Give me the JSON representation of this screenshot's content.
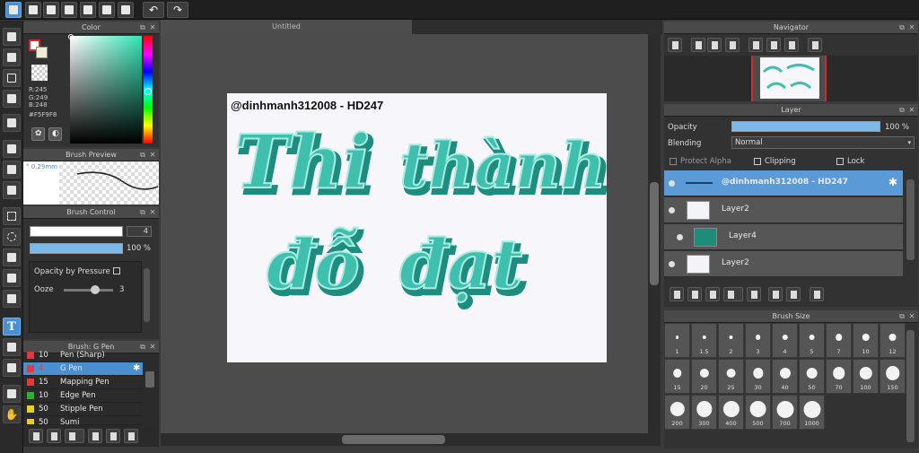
{
  "document_tab": "Untitled",
  "panels": {
    "color": {
      "title": "Color",
      "r": "R:245",
      "g": "G:249",
      "b": "B:248",
      "hex": "#F5F9F8"
    },
    "brush_preview": {
      "title": "Brush Preview",
      "size": "0.29mm"
    },
    "brush_control": {
      "title": "Brush Control",
      "size_value": "4",
      "opacity_value": "100 %",
      "opacity_by_pressure": "Opacity by Pressure",
      "ooze_label": "Ooze",
      "ooze_value": "3"
    },
    "brush_list": {
      "title": "Brush: G Pen",
      "items": [
        {
          "n": "10",
          "name": "Pen (Sharp)",
          "color": "#e03a3a"
        },
        {
          "n": "4",
          "name": "G Pen",
          "color": "#e03a3a",
          "selected": true
        },
        {
          "n": "15",
          "name": "Mapping Pen",
          "color": "#e03a3a"
        },
        {
          "n": "10",
          "name": "Edge Pen",
          "color": "#2db02d"
        },
        {
          "n": "50",
          "name": "Stipple Pen",
          "color": "#e8d020"
        },
        {
          "n": "50",
          "name": "Sumi",
          "color": "#e8d020"
        }
      ]
    },
    "navigator": {
      "title": "Navigator"
    },
    "layer": {
      "title": "Layer",
      "opacity_label": "Opacity",
      "opacity_value": "100 %",
      "blending_label": "Blending",
      "blending_value": "Normal",
      "protect_alpha": "Protect Alpha",
      "clipping": "Clipping",
      "lock": "Lock",
      "layers": [
        {
          "name": "@dinhmanh312008 - HD247",
          "kind": "text",
          "selected": true
        },
        {
          "name": "Layer2",
          "kind": "image"
        },
        {
          "name": "Layer4",
          "kind": "fill",
          "indent": true
        },
        {
          "name": "Layer2",
          "kind": "image"
        }
      ]
    },
    "brush_size": {
      "title": "Brush Size",
      "sizes": [
        "1",
        "1.5",
        "2",
        "3",
        "4",
        "5",
        "7",
        "10",
        "12",
        "15",
        "20",
        "25",
        "30",
        "40",
        "50",
        "70",
        "100",
        "150",
        "200",
        "300",
        "400",
        "500",
        "700",
        "1000"
      ]
    }
  },
  "artwork": {
    "watermark": "@dinhmanh312008 - HD247",
    "line1a": "Thi",
    "line1b": "thành",
    "line2a": "đỗ",
    "line2b": "đạt",
    "text_color": "#3fbfae",
    "shadow_color": "#1f8c80"
  },
  "colors": {
    "accent": "#4a8fd0",
    "fill_layer": "#1f8c7a"
  }
}
